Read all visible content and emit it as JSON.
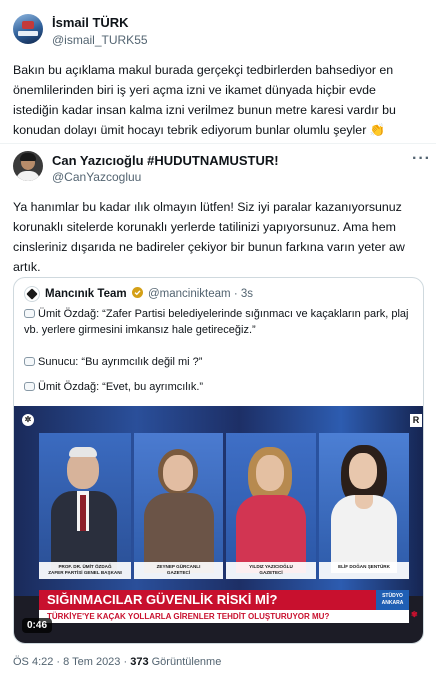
{
  "tweet1": {
    "author_name": "İsmail TÜRK",
    "author_handle": "@ismail_TURK55",
    "text": "Bakın bu açıklama makul burada gerçekçi tedbirlerden bahsediyor en önemlilerinden biri iş yeri açma izni ve ikamet dünyada hiçbir evde istediğin kadar insan kalma izni verilmez bunun metre karesi vardır bu konudan dolayı ümit hocayı tebrik ediyorum bunlar olumlu şeyler",
    "emoji": "👏"
  },
  "tweet2": {
    "author_name": "Can Yazıcıoğlu #HUDUTNAMUSTUR!",
    "author_handle": "@CanYazcogluu",
    "more_label": "···",
    "text": "Ya hanımlar bu kadar ılık olmayın lütfen! Siz iyi paralar kazanıyorsunuz korunaklı sitelerde korunaklı yerlerde tatilinizi yapıyorsunuz. Ama hem cinsleriniz dışarıda ne badireler çekiyor bir bunun farkına varın yeter aw artık.",
    "timestamp": "ÖS 4:22 · 8 Tem 2023 ·",
    "views_count": "373",
    "views_label": "Görüntülenme"
  },
  "quote": {
    "author_name": "Mancınık Team",
    "author_handle": "@mancinikteam",
    "time": "· 3s",
    "line1": "Ümit Özdağ: “Zafer Partisi belediyelerinde sığınmacı ve kaçakların park, plaj vb. yerlere girmesini imkansız hale getireceğiz.”",
    "line2": "Sunucu: “Bu ayrımcılık değil mi ?”",
    "line3": "Ümit Özdağ: “Evet, bu ayrımcılık.”",
    "video_duration": "0:46",
    "video": {
      "rating_badge": "R",
      "panel1_caption_name": "PROF. DR. ÜMİT ÖZDAĞ",
      "panel1_caption_title": "ZAFER PARTİSİ GENEL BAŞKANI",
      "panel2_caption_name": "ZEYNEP GÜRCANLI",
      "panel2_caption_title": "GAZETECİ",
      "panel3_caption_name": "YILDIZ YAZICIOĞLU",
      "panel3_caption_title": "GAZETECİ",
      "panel4_caption_name": "ELİF DOĞAN ŞENTÜRK",
      "headline": "SIĞINMACILAR GÜVENLİK RİSKİ Mİ?",
      "studio_label_1": "STÜDYO",
      "studio_label_2": "ANKARA",
      "ticker": "TÜRKİYE'YE KAÇAK YOLLARLA GİRENLER TEHDİT OLUŞTURUYOR MU?"
    }
  },
  "colors": {
    "verified": "#d4a017",
    "channel_red": "#c8102e",
    "studio_blue": "#1f5fb4"
  }
}
